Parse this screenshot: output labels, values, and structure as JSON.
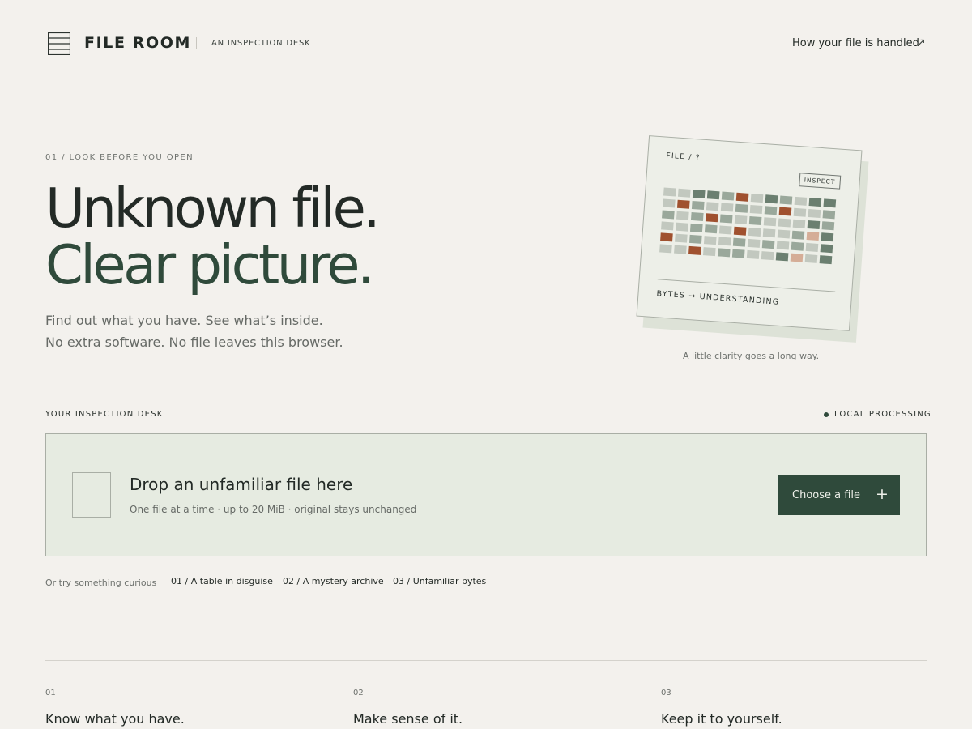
{
  "header": {
    "brand": "FILE ROOM",
    "tagline": "AN INSPECTION DESK",
    "link_label": "How your file is handled",
    "link_icon": "arrow-up-right-icon",
    "logo_icon": "file-stack-icon"
  },
  "hero": {
    "eyebrow": "01 / LOOK BEFORE YOU OPEN",
    "headline_line1": "Unknown file.",
    "headline_line2": "Clear picture.",
    "subline1": "Find out what you have. See what’s inside.",
    "subline2": "No extra software. No file leaves this browser."
  },
  "illustration": {
    "label": "FILE / ?",
    "stamp": "INSPECT",
    "footer": "BYTES → UNDERSTANDING",
    "caption": "A little clarity goes a long way.",
    "palette": {
      "l": "#c2c8bf",
      "m": "#9aa89b",
      "d": "#6b7f70",
      "r": "#a0512f",
      "p": "#d5ad97"
    },
    "rows": [
      "llddmrldmldd",
      "lrmllmlmrllm",
      "mlmrmlmllldm",
      "llmmlrlllmpd",
      "rlmllmlmlmld",
      "llrlmmlldpld"
    ]
  },
  "desk": {
    "title": "YOUR INSPECTION DESK",
    "status": "LOCAL PROCESSING",
    "drop_title": "Drop an unfamiliar file here",
    "drop_sub": "One file at a time · up to 20 MiB · original stays unchanged",
    "button_label": "Choose a file",
    "button_icon": "plus-icon"
  },
  "samples": {
    "label": "Or try something curious",
    "items": [
      "01 / A table in disguise",
      "02 / A mystery archive",
      "03 / Unfamiliar bytes"
    ]
  },
  "features": [
    {
      "num": "01",
      "title": "Know what you have."
    },
    {
      "num": "02",
      "title": "Make sense of it."
    },
    {
      "num": "03",
      "title": "Keep it to yourself."
    }
  ],
  "colors": {
    "background": "#f3f1ed",
    "accent": "#2f4a3b",
    "dropzone": "#e6ebe1"
  }
}
